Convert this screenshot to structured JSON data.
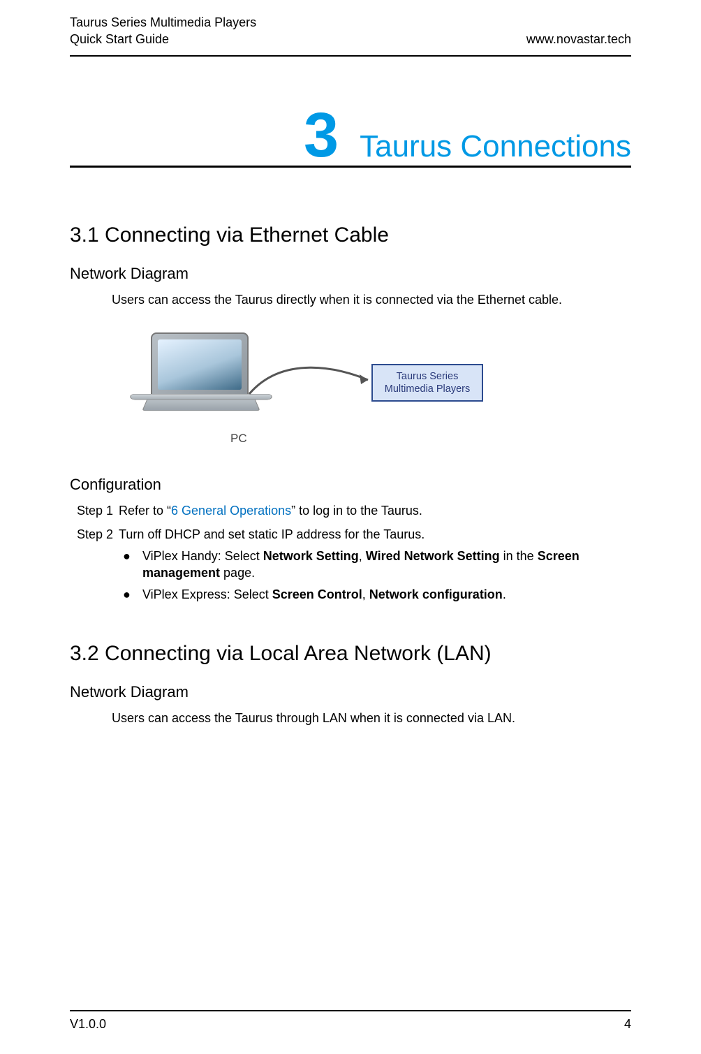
{
  "header": {
    "line1": "Taurus Series Multimedia Players",
    "line2": "Quick Start Guide",
    "right": "www.novastar.tech"
  },
  "chapter": {
    "number": "3",
    "title": "Taurus Connections"
  },
  "section31": {
    "heading": "3.1  Connecting via Ethernet Cable",
    "net_diag_label": "Network Diagram",
    "net_diag_text": "Users can access the Taurus directly when it is connected via the Ethernet cable.",
    "pc_label": "PC",
    "device_box": "Taurus Series Multimedia Players",
    "config_label": "Configuration",
    "step1_label": "Step 1",
    "step1_prefix": "Refer to “",
    "step1_link": "6 General Operations",
    "step1_suffix": "” to log in to the Taurus.",
    "step2_label": "Step 2",
    "step2_text": "Turn off DHCP and set static IP address for the Taurus.",
    "bullet1_a": "ViPlex Handy: Select ",
    "bullet1_b": "Network Setting",
    "bullet1_c": ", ",
    "bullet1_d": "Wired Network Setting",
    "bullet1_e": " in the ",
    "bullet1_f": "Screen management",
    "bullet1_g": " page.",
    "bullet2_a": "ViPlex Express: Select ",
    "bullet2_b": "Screen Control",
    "bullet2_c": ", ",
    "bullet2_d": "Network configuration",
    "bullet2_e": "."
  },
  "section32": {
    "heading": "3.2  Connecting via Local Area Network (LAN)",
    "net_diag_label": "Network Diagram",
    "net_diag_text": "Users can access the Taurus through LAN when it is connected via LAN."
  },
  "footer": {
    "version": "V1.0.0",
    "page": "4"
  }
}
